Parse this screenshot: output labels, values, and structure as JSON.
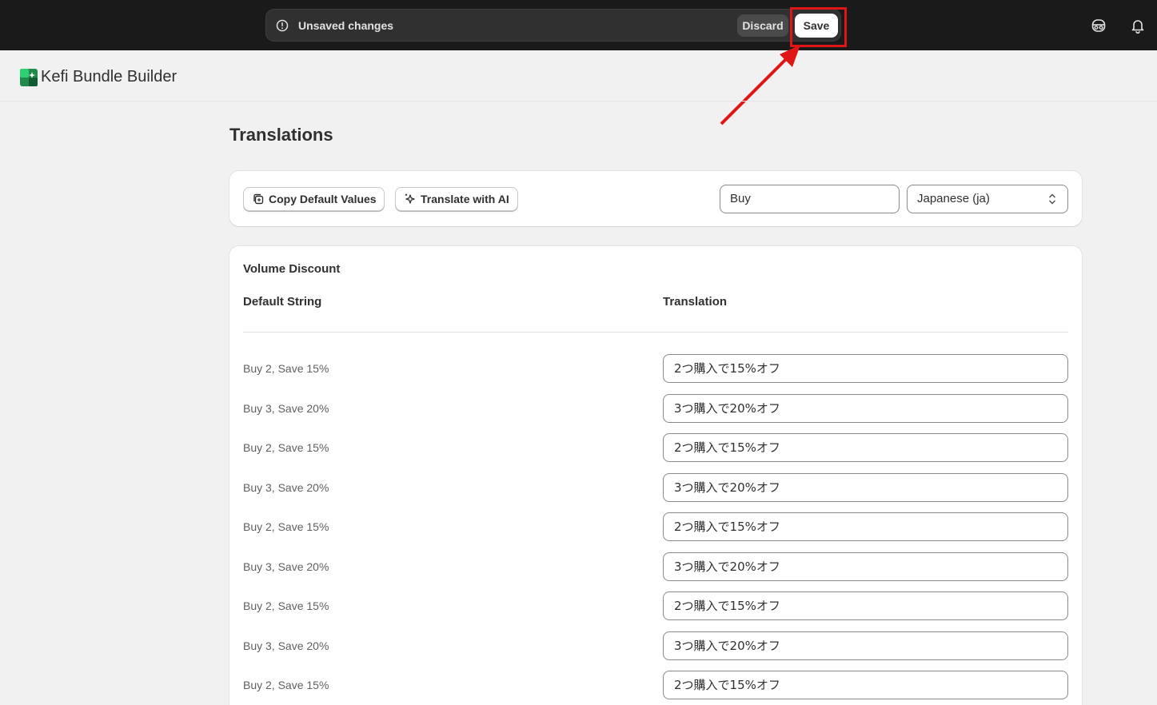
{
  "topbar": {
    "unsaved_label": "Unsaved changes",
    "discard_label": "Discard",
    "save_label": "Save"
  },
  "app": {
    "title": "Kefi Bundle Builder"
  },
  "page": {
    "title": "Translations"
  },
  "toolbar": {
    "copy_label": "Copy Default Values",
    "ai_label": "Translate with AI",
    "search_value": "Buy",
    "language_value": "Japanese (ja)"
  },
  "table": {
    "section_title": "Volume Discount",
    "col_default": "Default String",
    "col_translation": "Translation",
    "rows": [
      {
        "default": "Buy 2, Save 15%",
        "translation": "2つ購入で15%オフ"
      },
      {
        "default": "Buy 3, Save 20%",
        "translation": "3つ購入で20%オフ"
      },
      {
        "default": "Buy 2, Save 15%",
        "translation": "2つ購入で15%オフ"
      },
      {
        "default": "Buy 3, Save 20%",
        "translation": "3つ購入で20%オフ"
      },
      {
        "default": "Buy 2, Save 15%",
        "translation": "2つ購入で15%オフ"
      },
      {
        "default": "Buy 3, Save 20%",
        "translation": "3つ購入で20%オフ"
      },
      {
        "default": "Buy 2, Save 15%",
        "translation": "2つ購入で15%オフ"
      },
      {
        "default": "Buy 3, Save 20%",
        "translation": "3つ購入で20%オフ"
      },
      {
        "default": "Buy 2, Save 15%",
        "translation": "2つ購入で15%オフ"
      }
    ]
  },
  "colors": {
    "highlight": "#e01515",
    "topbar_bg": "#1a1a1a"
  }
}
